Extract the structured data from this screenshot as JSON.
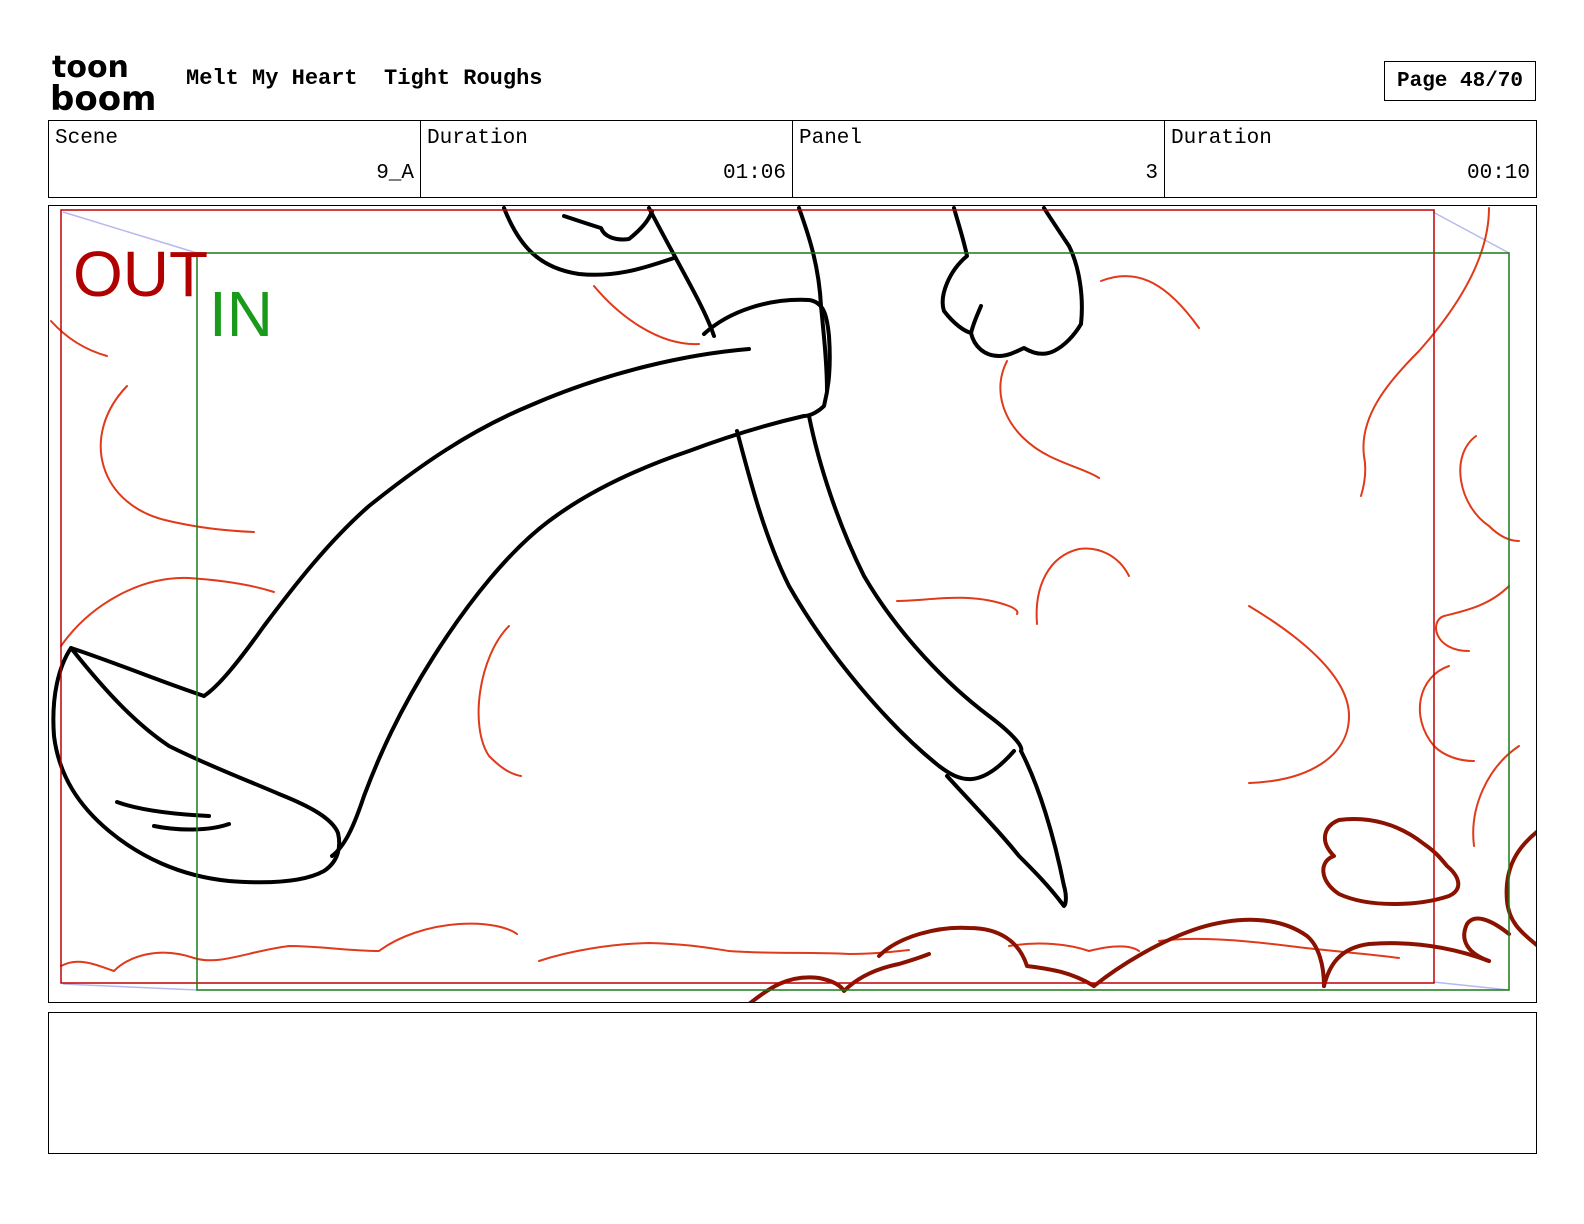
{
  "header": {
    "logo_text_top": "toon",
    "logo_text_bottom": "boom",
    "project_title": "Melt My Heart",
    "stage": "Tight Roughs",
    "page_label": "Page 48/70"
  },
  "info": {
    "scene_label": "Scene",
    "scene_value": "9_A",
    "scene_duration_label": "Duration",
    "scene_duration_value": "01:06",
    "panel_label": "Panel",
    "panel_value": "3",
    "panel_duration_label": "Duration",
    "panel_duration_value": "00:10"
  },
  "frame": {
    "out_label": "OUT",
    "in_label": "IN",
    "out_color": "#b00000",
    "in_color": "#1a9a1a"
  },
  "notes": {
    "text": ""
  }
}
